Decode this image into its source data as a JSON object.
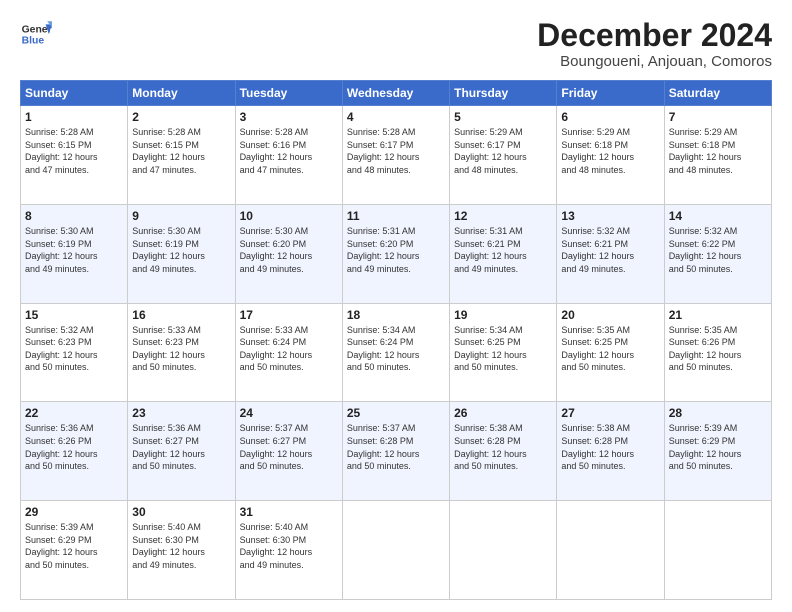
{
  "logo": {
    "line1": "General",
    "line2": "Blue"
  },
  "header": {
    "month": "December 2024",
    "location": "Boungoueni, Anjouan, Comoros"
  },
  "weekdays": [
    "Sunday",
    "Monday",
    "Tuesday",
    "Wednesday",
    "Thursday",
    "Friday",
    "Saturday"
  ],
  "weeks": [
    [
      {
        "day": "1",
        "info": "Sunrise: 5:28 AM\nSunset: 6:15 PM\nDaylight: 12 hours\nand 47 minutes."
      },
      {
        "day": "2",
        "info": "Sunrise: 5:28 AM\nSunset: 6:15 PM\nDaylight: 12 hours\nand 47 minutes."
      },
      {
        "day": "3",
        "info": "Sunrise: 5:28 AM\nSunset: 6:16 PM\nDaylight: 12 hours\nand 47 minutes."
      },
      {
        "day": "4",
        "info": "Sunrise: 5:28 AM\nSunset: 6:17 PM\nDaylight: 12 hours\nand 48 minutes."
      },
      {
        "day": "5",
        "info": "Sunrise: 5:29 AM\nSunset: 6:17 PM\nDaylight: 12 hours\nand 48 minutes."
      },
      {
        "day": "6",
        "info": "Sunrise: 5:29 AM\nSunset: 6:18 PM\nDaylight: 12 hours\nand 48 minutes."
      },
      {
        "day": "7",
        "info": "Sunrise: 5:29 AM\nSunset: 6:18 PM\nDaylight: 12 hours\nand 48 minutes."
      }
    ],
    [
      {
        "day": "8",
        "info": "Sunrise: 5:30 AM\nSunset: 6:19 PM\nDaylight: 12 hours\nand 49 minutes."
      },
      {
        "day": "9",
        "info": "Sunrise: 5:30 AM\nSunset: 6:19 PM\nDaylight: 12 hours\nand 49 minutes."
      },
      {
        "day": "10",
        "info": "Sunrise: 5:30 AM\nSunset: 6:20 PM\nDaylight: 12 hours\nand 49 minutes."
      },
      {
        "day": "11",
        "info": "Sunrise: 5:31 AM\nSunset: 6:20 PM\nDaylight: 12 hours\nand 49 minutes."
      },
      {
        "day": "12",
        "info": "Sunrise: 5:31 AM\nSunset: 6:21 PM\nDaylight: 12 hours\nand 49 minutes."
      },
      {
        "day": "13",
        "info": "Sunrise: 5:32 AM\nSunset: 6:21 PM\nDaylight: 12 hours\nand 49 minutes."
      },
      {
        "day": "14",
        "info": "Sunrise: 5:32 AM\nSunset: 6:22 PM\nDaylight: 12 hours\nand 50 minutes."
      }
    ],
    [
      {
        "day": "15",
        "info": "Sunrise: 5:32 AM\nSunset: 6:23 PM\nDaylight: 12 hours\nand 50 minutes."
      },
      {
        "day": "16",
        "info": "Sunrise: 5:33 AM\nSunset: 6:23 PM\nDaylight: 12 hours\nand 50 minutes."
      },
      {
        "day": "17",
        "info": "Sunrise: 5:33 AM\nSunset: 6:24 PM\nDaylight: 12 hours\nand 50 minutes."
      },
      {
        "day": "18",
        "info": "Sunrise: 5:34 AM\nSunset: 6:24 PM\nDaylight: 12 hours\nand 50 minutes."
      },
      {
        "day": "19",
        "info": "Sunrise: 5:34 AM\nSunset: 6:25 PM\nDaylight: 12 hours\nand 50 minutes."
      },
      {
        "day": "20",
        "info": "Sunrise: 5:35 AM\nSunset: 6:25 PM\nDaylight: 12 hours\nand 50 minutes."
      },
      {
        "day": "21",
        "info": "Sunrise: 5:35 AM\nSunset: 6:26 PM\nDaylight: 12 hours\nand 50 minutes."
      }
    ],
    [
      {
        "day": "22",
        "info": "Sunrise: 5:36 AM\nSunset: 6:26 PM\nDaylight: 12 hours\nand 50 minutes."
      },
      {
        "day": "23",
        "info": "Sunrise: 5:36 AM\nSunset: 6:27 PM\nDaylight: 12 hours\nand 50 minutes."
      },
      {
        "day": "24",
        "info": "Sunrise: 5:37 AM\nSunset: 6:27 PM\nDaylight: 12 hours\nand 50 minutes."
      },
      {
        "day": "25",
        "info": "Sunrise: 5:37 AM\nSunset: 6:28 PM\nDaylight: 12 hours\nand 50 minutes."
      },
      {
        "day": "26",
        "info": "Sunrise: 5:38 AM\nSunset: 6:28 PM\nDaylight: 12 hours\nand 50 minutes."
      },
      {
        "day": "27",
        "info": "Sunrise: 5:38 AM\nSunset: 6:28 PM\nDaylight: 12 hours\nand 50 minutes."
      },
      {
        "day": "28",
        "info": "Sunrise: 5:39 AM\nSunset: 6:29 PM\nDaylight: 12 hours\nand 50 minutes."
      }
    ],
    [
      {
        "day": "29",
        "info": "Sunrise: 5:39 AM\nSunset: 6:29 PM\nDaylight: 12 hours\nand 50 minutes."
      },
      {
        "day": "30",
        "info": "Sunrise: 5:40 AM\nSunset: 6:30 PM\nDaylight: 12 hours\nand 49 minutes."
      },
      {
        "day": "31",
        "info": "Sunrise: 5:40 AM\nSunset: 6:30 PM\nDaylight: 12 hours\nand 49 minutes."
      },
      null,
      null,
      null,
      null
    ]
  ]
}
